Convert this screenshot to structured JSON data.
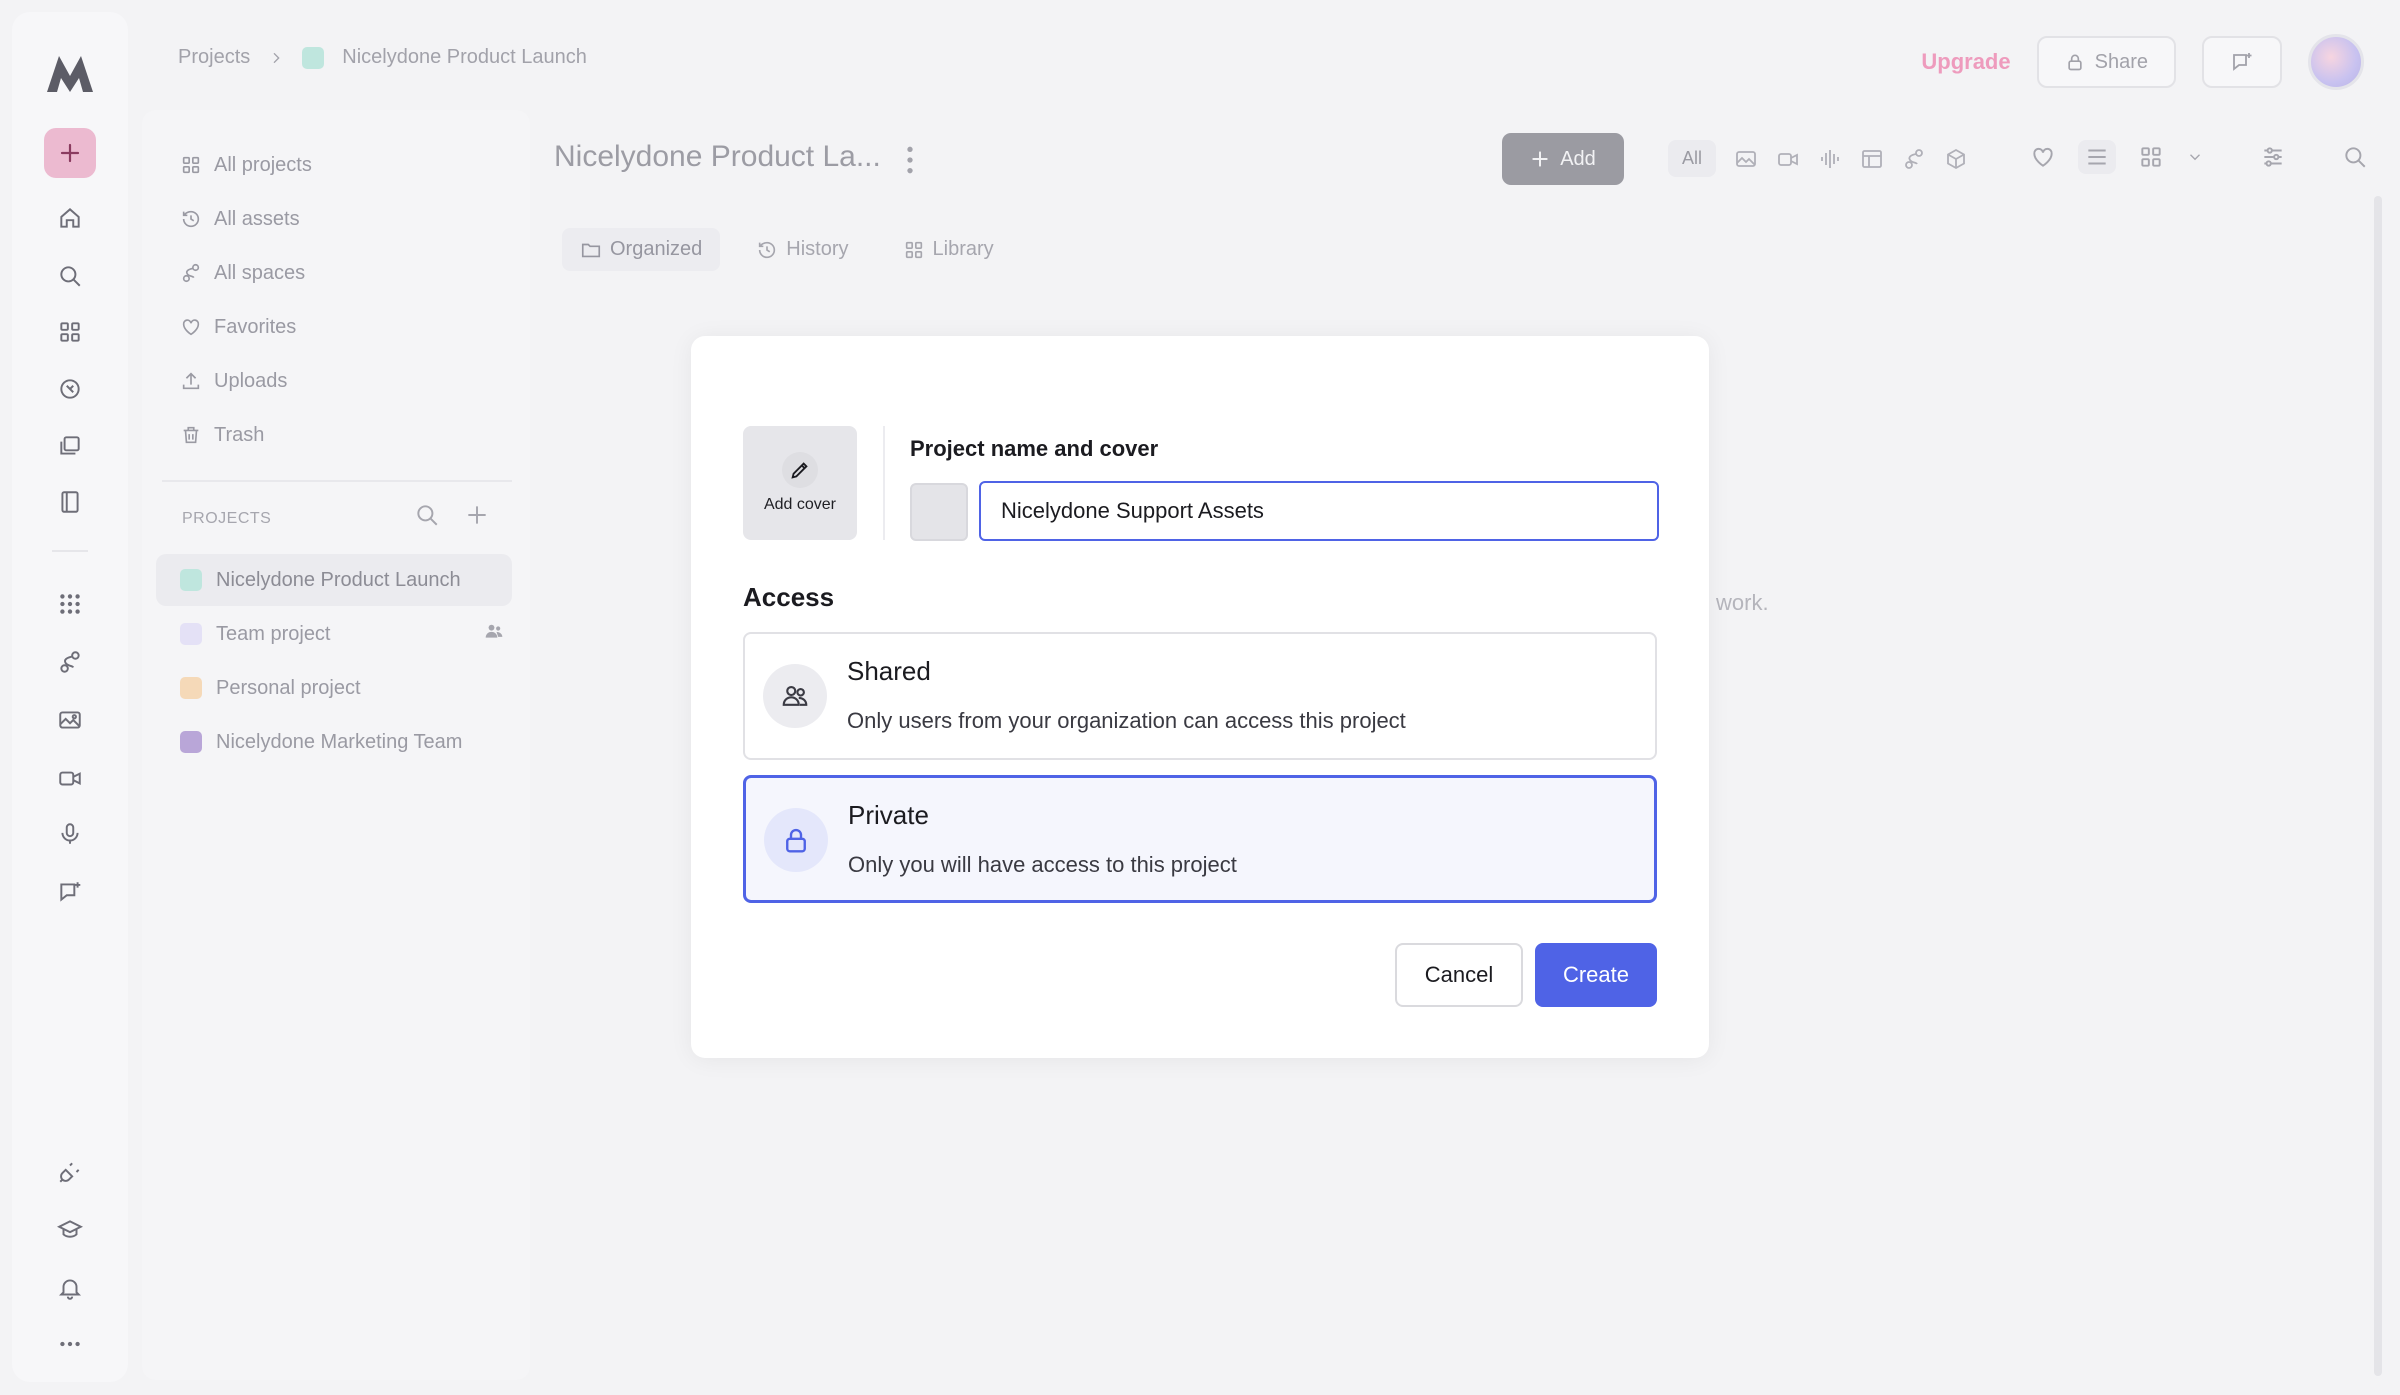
{
  "breadcrumb": {
    "root": "Projects",
    "current": "Nicelydone Product Launch",
    "current_color": "#bfe6de"
  },
  "topbar": {
    "upgrade_label": "Upgrade",
    "share_label": "Share"
  },
  "sidebar": {
    "nav": [
      {
        "label": "All projects",
        "icon": "grid-icon"
      },
      {
        "label": "All assets",
        "icon": "history-icon"
      },
      {
        "label": "All spaces",
        "icon": "spaces-icon"
      },
      {
        "label": "Favorites",
        "icon": "heart-icon"
      },
      {
        "label": "Uploads",
        "icon": "upload-icon"
      },
      {
        "label": "Trash",
        "icon": "trash-icon"
      }
    ],
    "projects_header": "PROJECTS",
    "projects": [
      {
        "label": "Nicelydone Product Launch",
        "color": "#bfe6de"
      },
      {
        "label": "Team project",
        "color": "#e4e1f6"
      },
      {
        "label": "Personal project",
        "color": "#f5d9b8"
      },
      {
        "label": "Nicelydone Marketing Team",
        "color": "#b9a6d8"
      }
    ]
  },
  "main": {
    "title": "Nicelydone Product La...",
    "add_label": "Add",
    "filter_all": "All",
    "tabs": [
      {
        "label": "Organized"
      },
      {
        "label": "History"
      },
      {
        "label": "Library"
      }
    ],
    "background_hint": "work."
  },
  "modal": {
    "cover_label": "Add cover",
    "name_label": "Project name and cover",
    "name_value": "Nicelydone Support Assets",
    "access_label": "Access",
    "options": [
      {
        "title": "Shared",
        "description": "Only users from your organization can access this project",
        "selected": false
      },
      {
        "title": "Private",
        "description": "Only you will have access to this project",
        "selected": true
      }
    ],
    "cancel_label": "Cancel",
    "create_label": "Create"
  },
  "colors": {
    "accent": "#4f63e6",
    "upgrade": "#ee9bbd",
    "new_button": "#ecbad0"
  }
}
